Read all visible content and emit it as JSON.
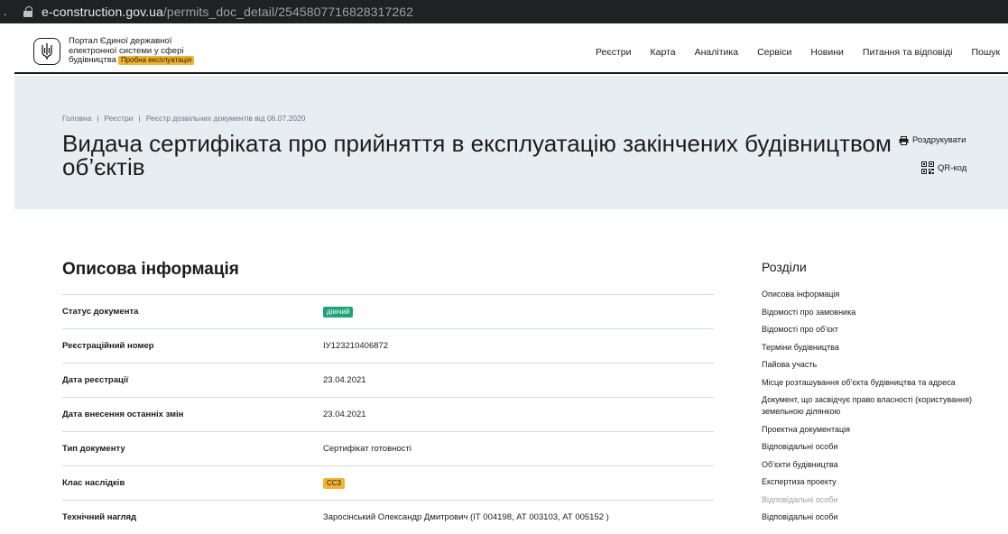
{
  "browser": {
    "url_domain": "e-construction.gov.ua",
    "url_path": "/permits_doc_detail/2545807716828317262",
    "left_glyph": "."
  },
  "header": {
    "portal_line1": "Портал Єдиної державної",
    "portal_line2": "електронної системи у сфері",
    "portal_line3": "будівництва",
    "beta_label": "Пробна експлуатація",
    "nav": [
      "Реєстри",
      "Карта",
      "Аналітика",
      "Сервіси",
      "Новини",
      "Питання та відповіді",
      "Пошук"
    ]
  },
  "breadcrumb": [
    "Головна",
    "Реєстри",
    "Реєстр дозвільних документів від 06.07.2020"
  ],
  "title": "Видача сертифіката про прийняття в експлуатацію закінчених будівництвом об’єктів",
  "actions": {
    "print_label": "Роздрукувати",
    "qr_label": "QR-код"
  },
  "section": {
    "title": "Описова інформація",
    "rows": [
      {
        "label": "Статус документа",
        "value": "діючий",
        "badge": "green"
      },
      {
        "label": "Реєстраційний номер",
        "value": "ІУ123210406872",
        "badge": ""
      },
      {
        "label": "Дата реєстрації",
        "value": "23.04.2021",
        "badge": ""
      },
      {
        "label": "Дата внесення останніх змін",
        "value": "23.04.2021",
        "badge": ""
      },
      {
        "label": "Тип документу",
        "value": "Сертифікат готовності",
        "badge": ""
      },
      {
        "label": "Клас наслідків",
        "value": "СС3",
        "badge": "orange"
      },
      {
        "label": "Технічний нагляд",
        "value": "Заросінський Олександр Дмитрович (ІТ 004198, АТ 003103, АТ 005152 )",
        "badge": ""
      }
    ]
  },
  "toc": {
    "title": "Розділи",
    "items": [
      {
        "label": "Описова інформація",
        "muted": false
      },
      {
        "label": "Відомості про замовника",
        "muted": false
      },
      {
        "label": "Відомості про об’єкт",
        "muted": false
      },
      {
        "label": "Терміни будівництва",
        "muted": false
      },
      {
        "label": "Пайова участь",
        "muted": false
      },
      {
        "label": "Місце розташування об’єкта будівництва та адреса",
        "muted": false
      },
      {
        "label": "Документ, що засвідчує право власності (користування) земельною ділянкою",
        "muted": false
      },
      {
        "label": "Проектна документація",
        "muted": false
      },
      {
        "label": "Відповідальні особи",
        "muted": false
      },
      {
        "label": "Об’єкти будівництва",
        "muted": false
      },
      {
        "label": "Експертиза проекту",
        "muted": false
      },
      {
        "label": "Відповідальні особи",
        "muted": true
      },
      {
        "label": "Відповідальні особи",
        "muted": false
      }
    ]
  },
  "colors": {
    "band": "#e8edf2",
    "badge_green": "#1fa37a",
    "badge_orange": "#f2b330"
  }
}
